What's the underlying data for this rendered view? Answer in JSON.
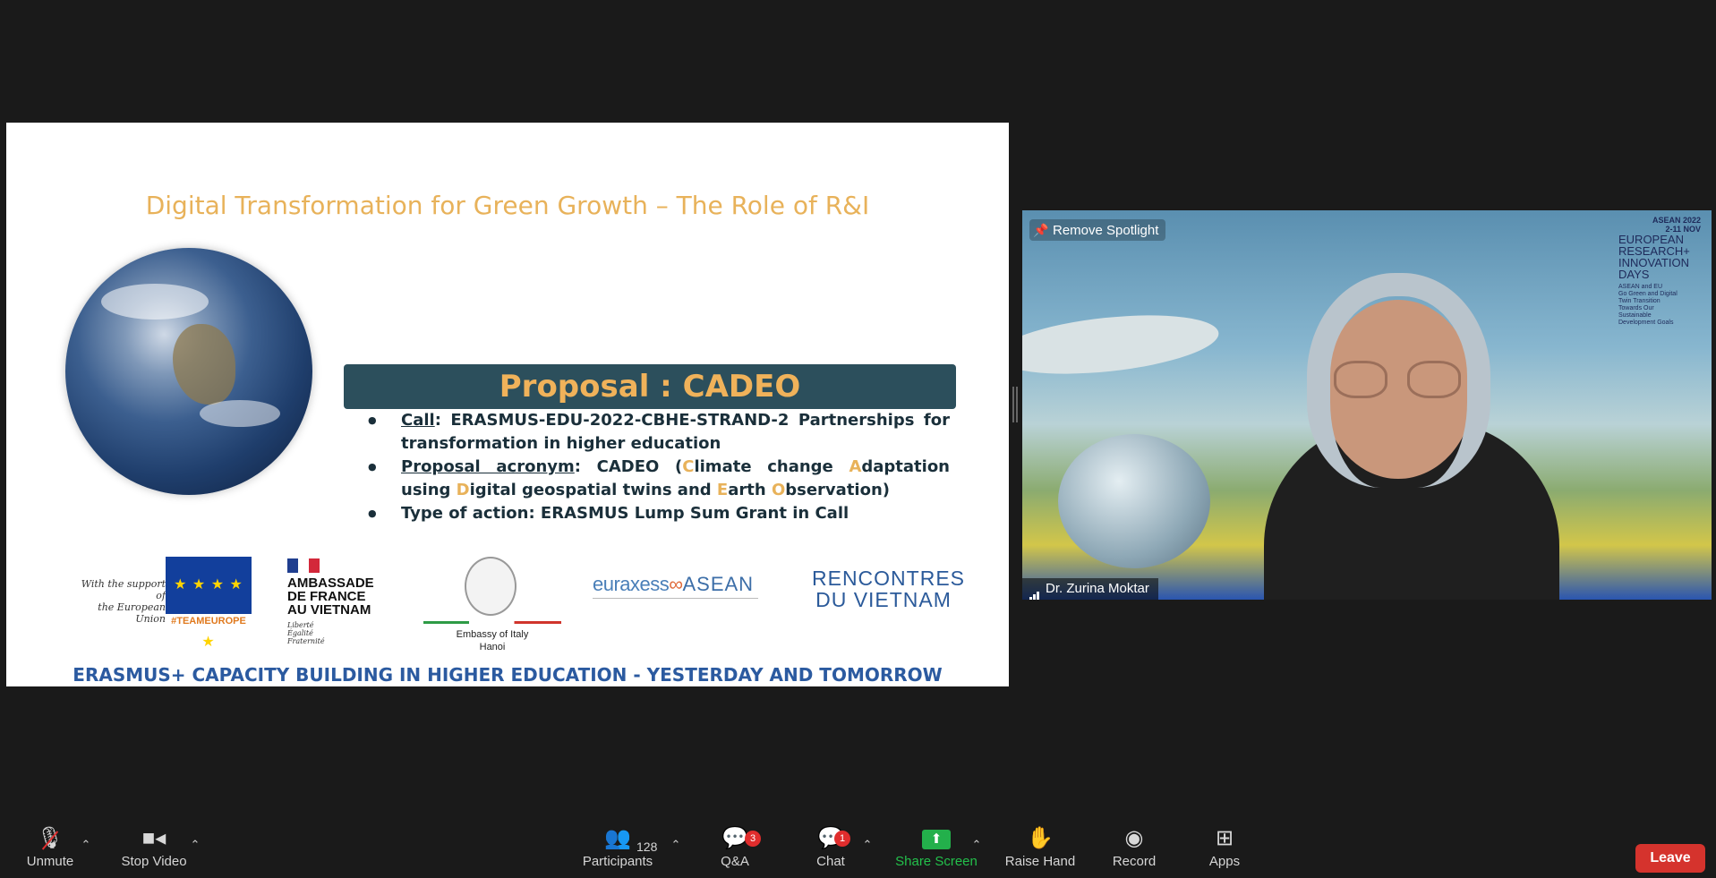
{
  "slide": {
    "title": "Digital Transformation for Green Growth – The Role of R&I",
    "proposal_title": "Proposal : CADEO",
    "bullets": {
      "call_label": "Call",
      "call_text": ": ERASMUS-EDU-2022-CBHE-STRAND-2 Partnerships for transformation in higher education",
      "acronym_label": "Proposal acronym",
      "acronym_text_1": ": CADEO (",
      "acronym_C": "C",
      "acronym_text_2": "limate change ",
      "acronym_A": "A",
      "acronym_text_3": "daptation using ",
      "acronym_D": "D",
      "acronym_text_4": "igital geospatial twins and ",
      "acronym_E": "E",
      "acronym_text_5": "arth ",
      "acronym_O": "O",
      "acronym_text_6": "bservation)",
      "action_text": "Type of action: ERASMUS Lump Sum Grant in Call"
    },
    "logos": {
      "eu_support_line1": "With the support of",
      "eu_support_line2": "the European Union",
      "team_europe": "#TEAMEUROPE",
      "france_line1": "AMBASSADE",
      "france_line2": "DE FRANCE",
      "france_line3": "AU VIETNAM",
      "france_motto1": "Liberté",
      "france_motto2": "Égalité",
      "france_motto3": "Fraternité",
      "italy_line1": "Embassy of Italy",
      "italy_line2": "Hanoi",
      "euraxess_a": "euraxess",
      "euraxess_b": "ASEAN",
      "rencontres_line1": "RENCONTRES",
      "rencontres_line2": "DU VIETNAM"
    },
    "footer": "ERASMUS+ CAPACITY BUILDING IN HIGHER EDUCATION - YESTERDAY AND TOMORROW"
  },
  "video": {
    "spotlight_label": "Remove Spotlight",
    "participant_name": "Dr. Zurina Moktar",
    "badge": {
      "year": "ASEAN 2022",
      "dates": "2-11 NOV",
      "line1": "EUROPEAN",
      "line2": "RESEARCH+",
      "line3": "INNOVATION",
      "line4": "DAYS",
      "sub1": "ASEAN and EU",
      "sub2": "Go Green and Digital",
      "sub3": "Twin Transition",
      "sub4": "Towards Our",
      "sub5": "Sustainable",
      "sub6": "Development Goals"
    }
  },
  "toolbar": {
    "unmute": "Unmute",
    "stop_video": "Stop Video",
    "participants": "Participants",
    "participants_count": "128",
    "qa": "Q&A",
    "qa_badge": "3",
    "chat": "Chat",
    "chat_badge": "1",
    "share_screen": "Share Screen",
    "raise_hand": "Raise Hand",
    "record": "Record",
    "apps": "Apps",
    "leave": "Leave"
  },
  "colors": {
    "share_green": "#23b04b",
    "leave_red": "#d5332d",
    "slide_accent": "#e8b25a",
    "proposal_bar": "#2c4f5c"
  }
}
